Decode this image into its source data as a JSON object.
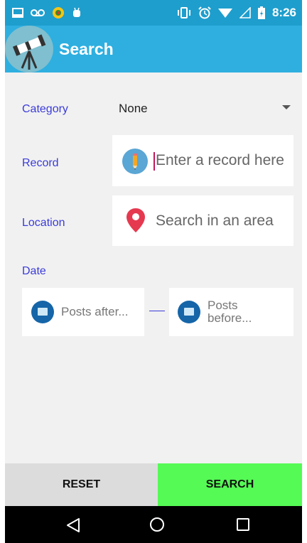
{
  "status_bar": {
    "time": "8:26"
  },
  "app_bar": {
    "title": "Search",
    "colors": {
      "primary": "#2eafe0",
      "status": "#1e9ecd"
    }
  },
  "form": {
    "category": {
      "label": "Category",
      "value": "None"
    },
    "record": {
      "label": "Record",
      "placeholder": "Enter a record here"
    },
    "location": {
      "label": "Location",
      "placeholder": "Search in an area"
    },
    "date": {
      "label": "Date",
      "after_placeholder": "Posts after...",
      "before_placeholder_line1": "Posts",
      "before_placeholder_line2": "before..."
    }
  },
  "actions": {
    "reset_label": "RESET",
    "search_label": "SEARCH",
    "search_color": "#55fa55"
  },
  "icons": {
    "status_left": [
      "screen-icon",
      "voicemail-icon",
      "app-notification-icon",
      "android-debug-icon"
    ],
    "status_right": [
      "vibrate-icon",
      "alarm-icon",
      "wifi-icon",
      "signal-icon",
      "battery-icon"
    ],
    "record_field": "pencil-icon",
    "location_field": "map-pin-icon",
    "date_fields": "calendar-icon"
  }
}
